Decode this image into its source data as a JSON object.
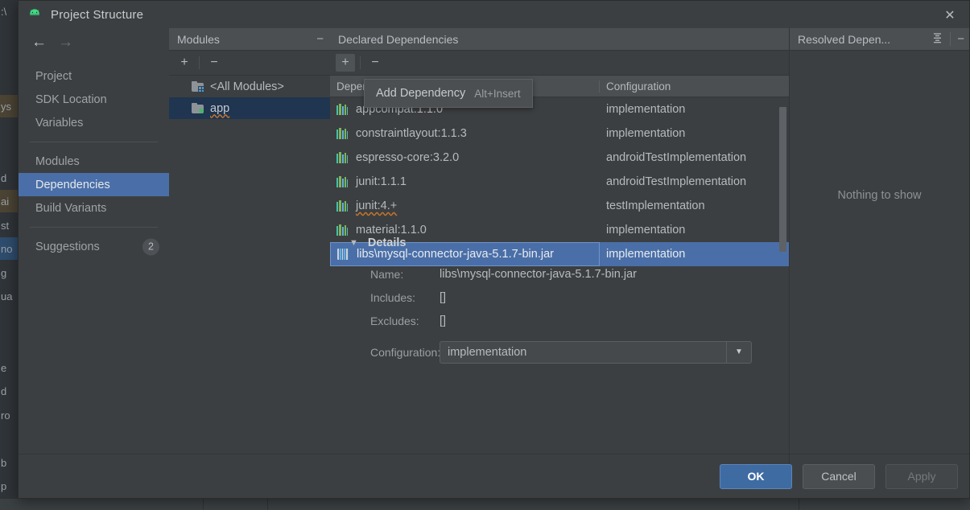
{
  "window": {
    "title": "Project Structure",
    "app_icon": "android-robot-icon",
    "close_icon": "close-icon"
  },
  "nav": {
    "back_icon": "arrow-left-icon",
    "forward_icon": "arrow-right-icon",
    "items": [
      {
        "label": "Project",
        "selected": false
      },
      {
        "label": "SDK Location",
        "selected": false
      },
      {
        "label": "Variables",
        "selected": false
      },
      {
        "label": "Modules",
        "selected": false
      },
      {
        "label": "Dependencies",
        "selected": true
      },
      {
        "label": "Build Variants",
        "selected": false
      },
      {
        "label": "Suggestions",
        "selected": false,
        "badge": "2"
      }
    ]
  },
  "modules_panel": {
    "title": "Modules",
    "collapse_icon": "minimize-icon",
    "add_label": "+",
    "remove_label": "−",
    "rows": [
      {
        "label": "<All Modules>",
        "icon": "folder-modules-icon",
        "selected": false
      },
      {
        "label": "app",
        "icon": "folder-app-icon",
        "selected": true
      }
    ]
  },
  "declared_panel": {
    "title": "Declared Dependencies",
    "add_label": "+",
    "remove_label": "−",
    "columns": [
      "Dependency",
      "Configuration"
    ],
    "rows": [
      {
        "name": "appcompat:1.1.0",
        "configuration": "implementation",
        "icon": "library-icon",
        "selected": false,
        "warn": false
      },
      {
        "name": "constraintlayout:1.1.3",
        "configuration": "implementation",
        "icon": "library-icon",
        "selected": false,
        "warn": false
      },
      {
        "name": "espresso-core:3.2.0",
        "configuration": "androidTestImplementation",
        "icon": "library-icon",
        "selected": false,
        "warn": false
      },
      {
        "name": "junit:1.1.1",
        "configuration": "androidTestImplementation",
        "icon": "library-icon",
        "selected": false,
        "warn": false
      },
      {
        "name": "junit:4.+",
        "configuration": "testImplementation",
        "icon": "library-icon",
        "selected": false,
        "warn": true
      },
      {
        "name": "material:1.1.0",
        "configuration": "implementation",
        "icon": "library-icon",
        "selected": false,
        "warn": false
      },
      {
        "name": "libs\\mysql-connector-java-5.1.7-bin.jar",
        "configuration": "implementation",
        "icon": "jar-icon",
        "selected": true,
        "warn": false
      }
    ]
  },
  "tooltip": {
    "label": "Add Dependency",
    "shortcut": "Alt+Insert"
  },
  "details": {
    "title": "Details",
    "expander_icon": "triangle-down-icon",
    "fields": [
      {
        "label": "Name:",
        "value": "libs\\mysql-connector-java-5.1.7-bin.jar"
      },
      {
        "label": "Includes:",
        "value": "[]"
      },
      {
        "label": "Excludes:",
        "value": "[]"
      }
    ],
    "configuration": {
      "label": "Configuration:",
      "value": "implementation",
      "dropdown_icon": "chevron-down-icon"
    }
  },
  "resolved_panel": {
    "title": "Resolved Depen...",
    "collapse_all_icon": "collapse-all-icon",
    "minimize_icon": "minimize-icon",
    "empty_text": "Nothing to show"
  },
  "footer": {
    "ok": "OK",
    "cancel": "Cancel",
    "apply": "Apply"
  },
  "background": {
    "left_gutter_text": ":\\\n\n\n\nys\n\n\nd\nai\nst\nno\ng\nua\n\n\ne\nd\nro\n\nb\np\ng"
  },
  "colors": {
    "accent_selection": "#4a6fa8",
    "module_selection": "#1f3550",
    "primary_button": "#3f6ba3",
    "panel_header": "#4b4f52",
    "dialog_bg": "#3c3f41",
    "warning_underline": "#c8762c"
  }
}
